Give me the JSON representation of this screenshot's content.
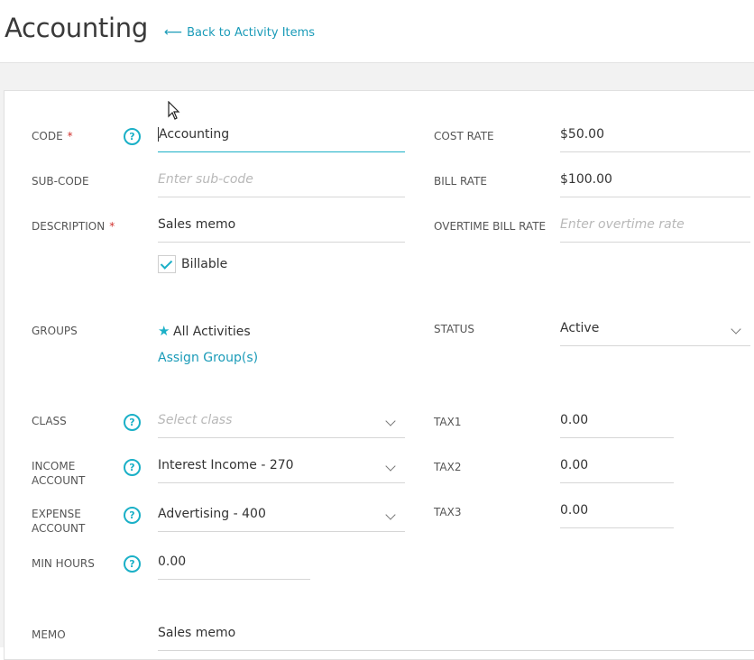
{
  "header": {
    "title": "Accounting",
    "back_link": "Back to Activity Items",
    "back_arrow": "⟵"
  },
  "form": {
    "code": {
      "label": "CODE",
      "required": "*",
      "value": "Accounting"
    },
    "sub_code": {
      "label": "SUB-CODE",
      "placeholder": "Enter sub-code"
    },
    "description": {
      "label": "DESCRIPTION",
      "required": "*",
      "value": "Sales memo"
    },
    "billable": {
      "label": "Billable",
      "checked": true
    },
    "groups": {
      "label": "GROUPS",
      "value": "All Activities",
      "assign_link": "Assign Group(s)"
    },
    "class": {
      "label": "CLASS",
      "placeholder": "Select class"
    },
    "income_account": {
      "label": "INCOME ACCOUNT",
      "value": "Interest Income - 270"
    },
    "expense_account": {
      "label": "EXPENSE ACCOUNT",
      "value": "Advertising - 400"
    },
    "min_hours": {
      "label": "MIN HOURS",
      "value": "0.00"
    },
    "memo": {
      "label": "MEMO",
      "value": "Sales memo"
    },
    "cost_rate": {
      "label": "COST RATE",
      "value": "$50.00"
    },
    "bill_rate": {
      "label": "BILL RATE",
      "value": "$100.00"
    },
    "overtime_bill_rate": {
      "label": "OVERTIME BILL RATE",
      "placeholder": "Enter overtime rate"
    },
    "status": {
      "label": "STATUS",
      "value": "Active"
    },
    "tax1": {
      "label": "TAX1",
      "value": "0.00"
    },
    "tax2": {
      "label": "TAX2",
      "value": "0.00"
    },
    "tax3": {
      "label": "TAX3",
      "value": "0.00"
    },
    "help_glyph": "?"
  },
  "colors": {
    "accent": "#1bb0c7",
    "link": "#1a9bb8",
    "required": "#d0312d"
  }
}
